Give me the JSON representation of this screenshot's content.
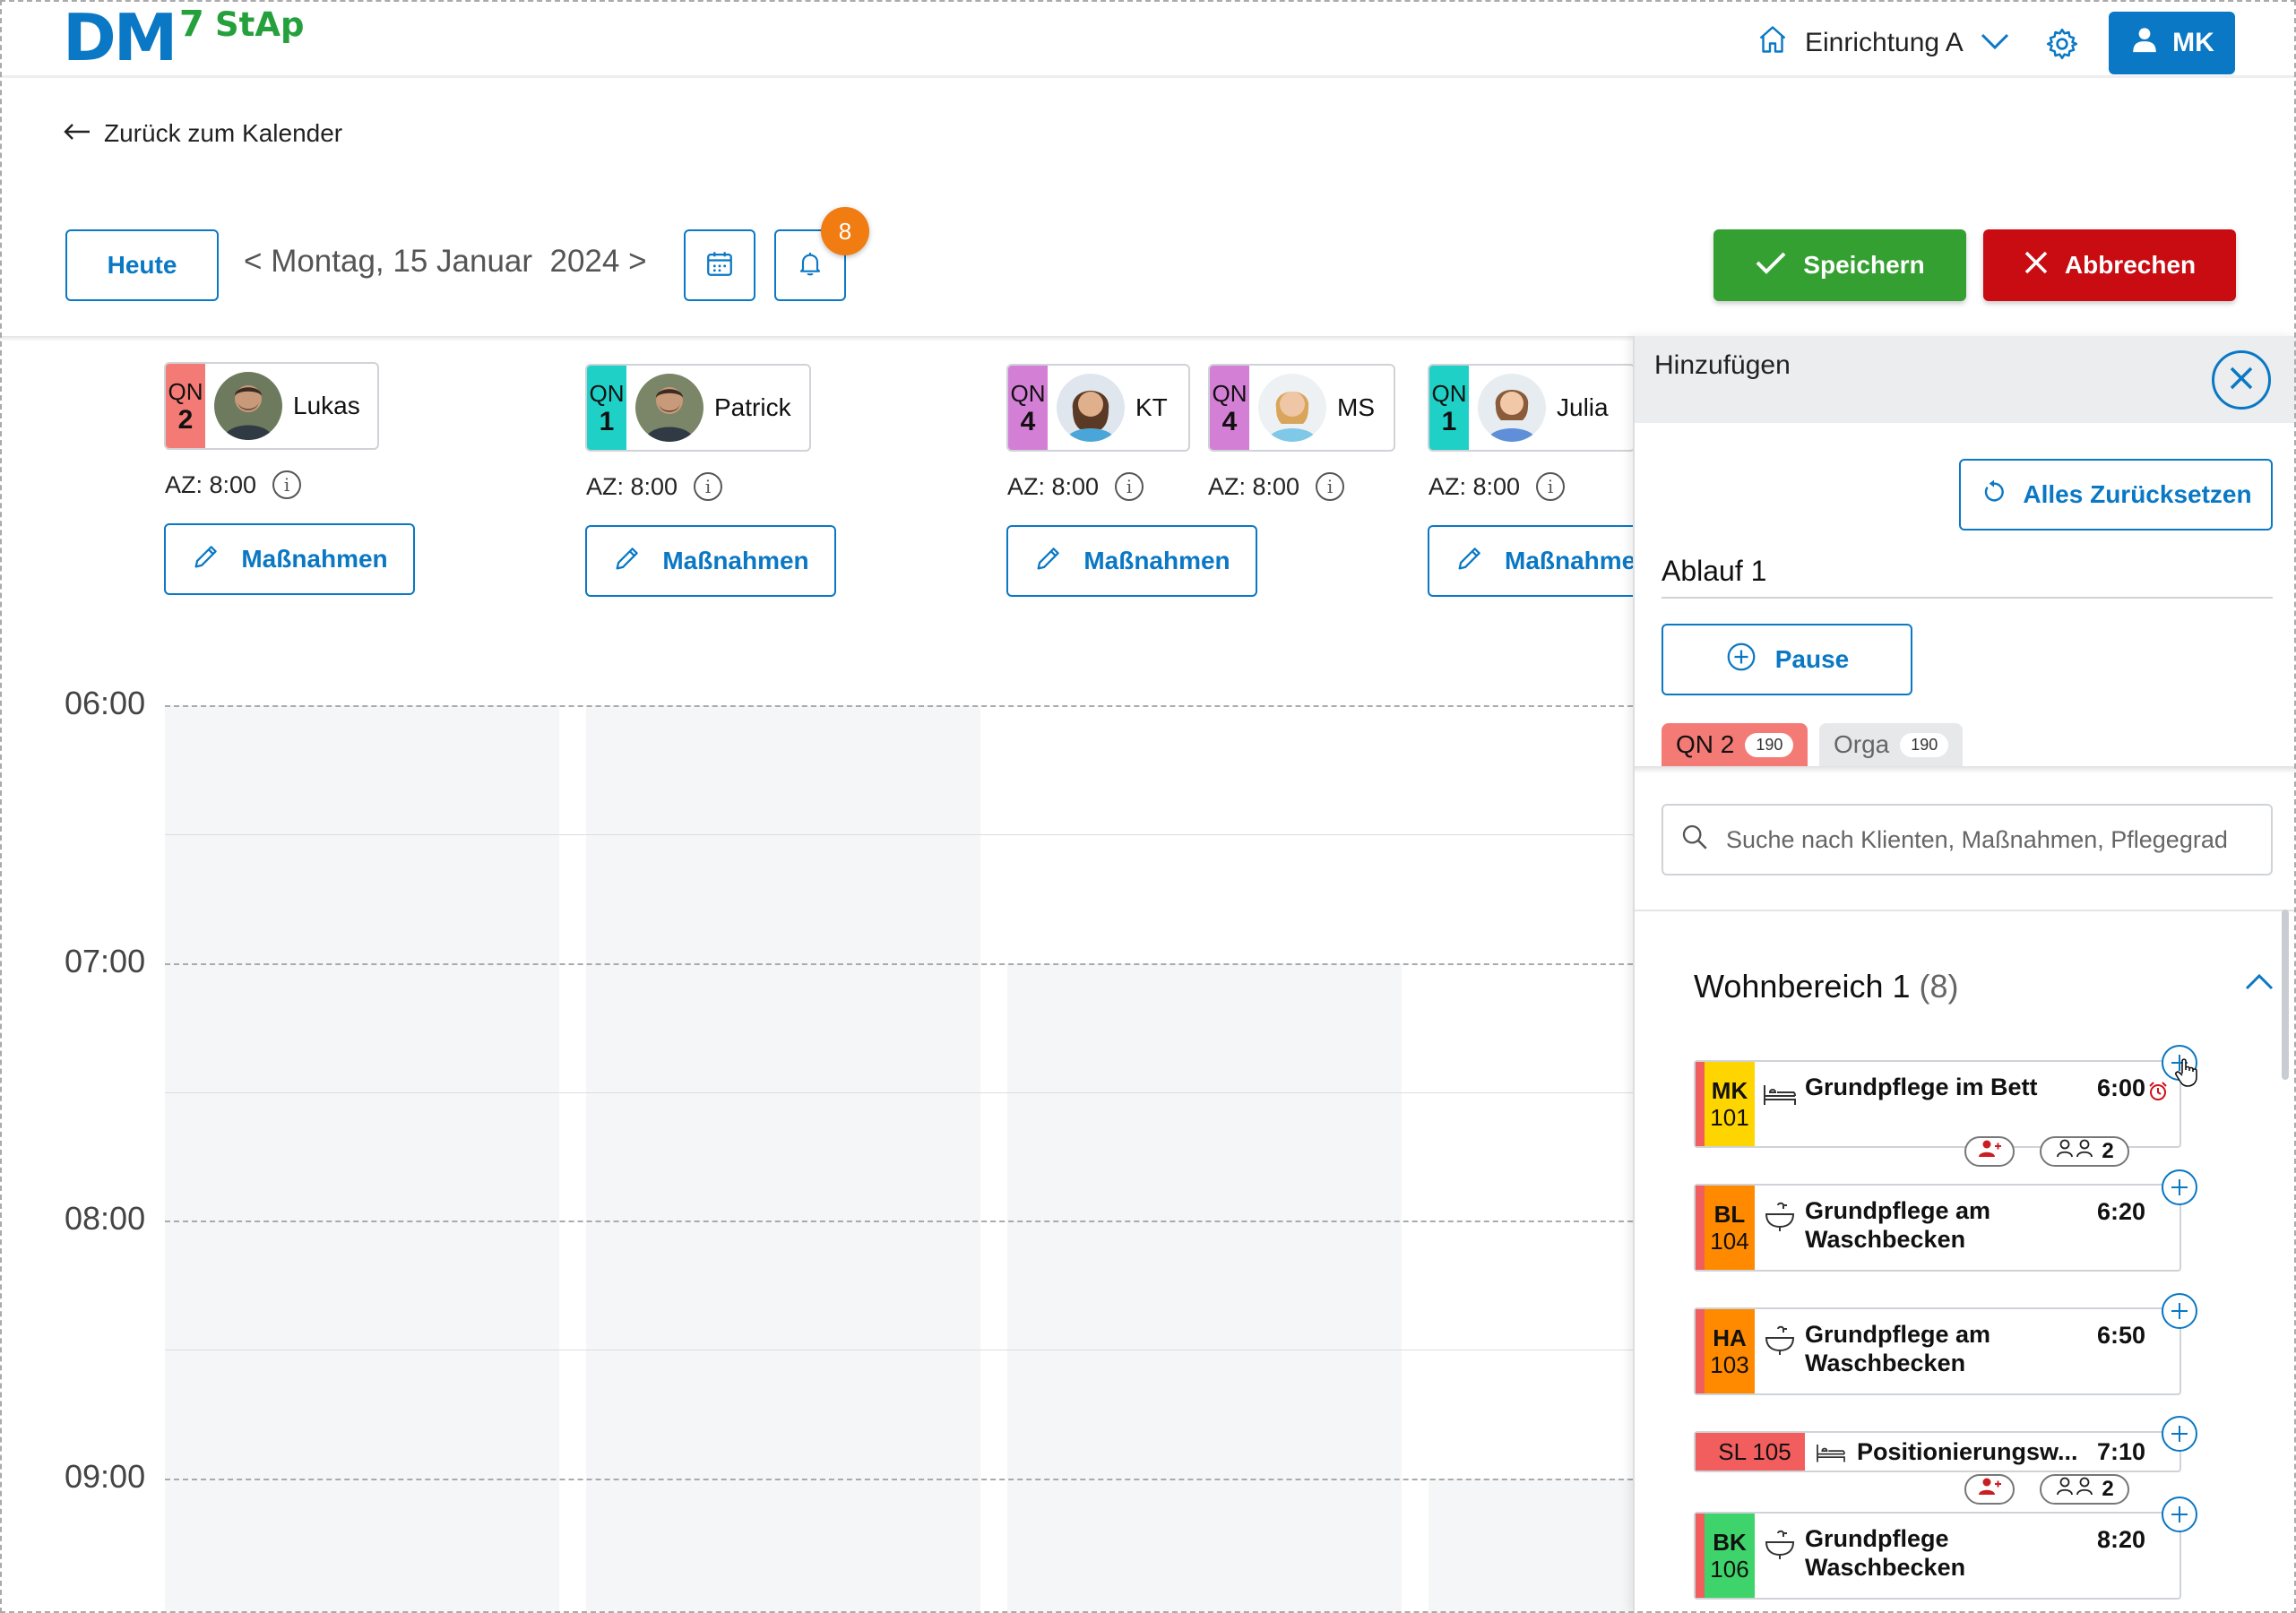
{
  "header": {
    "logo_main": "DM",
    "logo_sup": "7",
    "logo_sub": "StAp",
    "facility": "Einrichtung A",
    "user_initials": "MK",
    "brand_color": "#0a78c4"
  },
  "nav": {
    "back_label": "Zurück zum Kalender"
  },
  "toolbar": {
    "today_label": "Heute",
    "date_prev": "<",
    "date_text": "Montag, 15 Januar  2024",
    "date_next": ">",
    "notification_count": "8",
    "save_label": "Speichern",
    "cancel_label": "Abbrechen"
  },
  "staff": [
    {
      "qn_label": "QN",
      "qn_level": "2",
      "qn_color": "#f47a76",
      "name": "Lukas",
      "az": "AZ: 8:00",
      "button": "Maßnahmen"
    },
    {
      "qn_label": "QN",
      "qn_level": "1",
      "qn_color": "#1fd0c7",
      "name": "Patrick",
      "az": "AZ: 8:00",
      "button": "Maßnahmen"
    },
    {
      "qn_label": "QN",
      "qn_level": "4",
      "qn_color": "#d47fd6",
      "name": "KT",
      "az": "AZ: 8:00",
      "button": "Maßnahmen"
    },
    {
      "qn_label": "QN",
      "qn_level": "4",
      "qn_color": "#d47fd6",
      "name": "MS",
      "az": "AZ: 8:00",
      "button": ""
    },
    {
      "qn_label": "QN",
      "qn_level": "1",
      "qn_color": "#1fd0c7",
      "name": "Julia",
      "az": "AZ: 8:00",
      "button": "Maßnahmen"
    }
  ],
  "timeline": {
    "hours": [
      "06:00",
      "07:00",
      "08:00",
      "09:00"
    ]
  },
  "panel": {
    "title": "Hinzufügen",
    "reset_label": "Alles Zurücksetzen",
    "ablauf_label": "Ablauf 1",
    "pause_label": "Pause",
    "tabs": [
      {
        "label": "QN 2",
        "count": "190",
        "color": "#f47a76"
      },
      {
        "label": "Orga",
        "count": "190",
        "color": "#e6e8ea"
      }
    ],
    "search_placeholder": "Suche nach Klienten, Maßnahmen, Pflegegrad",
    "section_title": "Wohnbereich 1",
    "section_count": "(8)",
    "tasks": [
      {
        "initials": "MK",
        "room": "101",
        "client_color": "#ffd500",
        "strip_color": "#f25e5e",
        "icon": "bed-icon",
        "name": "Grundpflege im Bett",
        "time": "6:00",
        "alarm": true,
        "pills": true,
        "pill_count": "2"
      },
      {
        "initials": "BL",
        "room": "104",
        "client_color": "#ff8a00",
        "strip_color": "#f25e5e",
        "icon": "sink-icon",
        "name": "Grundpflege am Waschbecken",
        "time": "6:20",
        "alarm": false,
        "pills": false
      },
      {
        "initials": "HA",
        "room": "103",
        "client_color": "#ff8a00",
        "strip_color": "#f25e5e",
        "icon": "sink-icon",
        "name": "Grundpflege am Waschbecken",
        "time": "6:50",
        "alarm": false,
        "pills": false
      },
      {
        "initials": "SL 105",
        "room": "",
        "client_color": "#f25e5e",
        "strip_color": "#f25e5e",
        "icon": "bed-icon",
        "name": "Positionierungsw...",
        "time": "7:10",
        "alarm": false,
        "pills": true,
        "pill_count": "2"
      },
      {
        "initials": "BK",
        "room": "106",
        "client_color": "#3ed46b",
        "strip_color": "#f25e5e",
        "icon": "sink-icon",
        "name": "Grundpflege Waschbecken",
        "time": "8:20",
        "alarm": false,
        "pills": false
      }
    ]
  }
}
